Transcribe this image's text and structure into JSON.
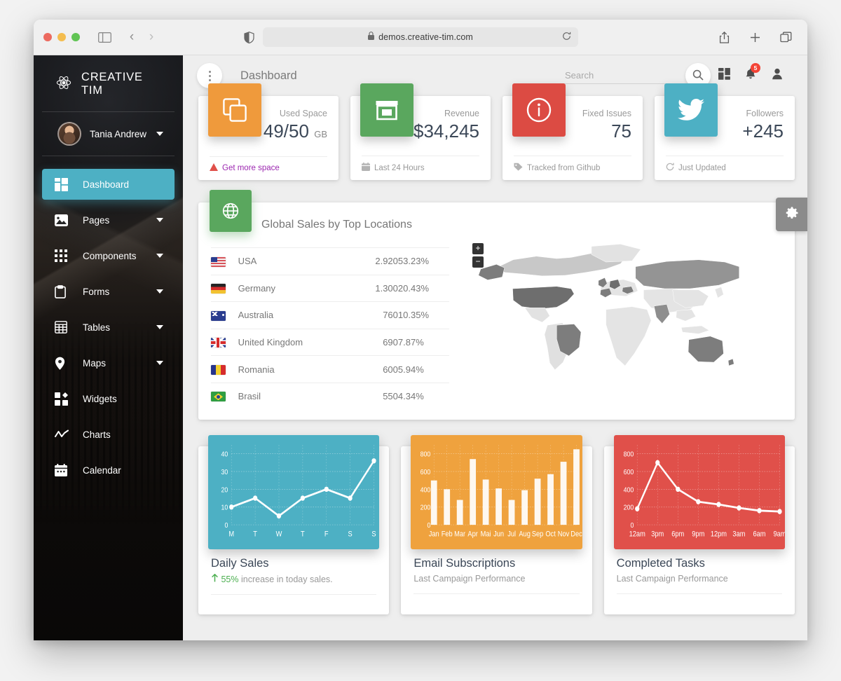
{
  "browser": {
    "url": "demos.creative-tim.com",
    "lock_icon": "lock-icon",
    "reload_icon": "reload-icon"
  },
  "sidebar": {
    "brand": "CREATIVE TIM",
    "user": {
      "name": "Tania Andrew"
    },
    "items": [
      {
        "label": "Dashboard",
        "icon": "dashboard-icon",
        "active": true,
        "caret": false
      },
      {
        "label": "Pages",
        "icon": "image-icon",
        "active": false,
        "caret": true
      },
      {
        "label": "Components",
        "icon": "apps-grid-icon",
        "active": false,
        "caret": true
      },
      {
        "label": "Forms",
        "icon": "clipboard-icon",
        "active": false,
        "caret": true
      },
      {
        "label": "Tables",
        "icon": "table-grid-icon",
        "active": false,
        "caret": true
      },
      {
        "label": "Maps",
        "icon": "map-pin-icon",
        "active": false,
        "caret": true
      },
      {
        "label": "Widgets",
        "icon": "widgets-icon",
        "active": false,
        "caret": false
      },
      {
        "label": "Charts",
        "icon": "line-chart-icon",
        "active": false,
        "caret": false
      },
      {
        "label": "Calendar",
        "icon": "calendar-icon",
        "active": false,
        "caret": false
      }
    ]
  },
  "topbar": {
    "title": "Dashboard",
    "search_placeholder": "Search",
    "search_value": "",
    "notification_count": "5"
  },
  "stats": [
    {
      "label": "Used Space",
      "value": "49/50",
      "unit": "GB",
      "footer": "Get more space",
      "footer_icon": "warning-triangle-icon",
      "footer_style": "link",
      "color": "#ef9a3c",
      "icon": "copy-icon"
    },
    {
      "label": "Revenue",
      "value": "$34,245",
      "unit": "",
      "footer": "Last 24 Hours",
      "footer_icon": "calendar-icon",
      "footer_style": "muted",
      "color": "#5aa75e",
      "icon": "store-icon"
    },
    {
      "label": "Fixed Issues",
      "value": "75",
      "unit": "",
      "footer": "Tracked from Github",
      "footer_icon": "tag-icon",
      "footer_style": "muted",
      "color": "#dc4b43",
      "icon": "info-circle-icon"
    },
    {
      "label": "Followers",
      "value": "+245",
      "unit": "",
      "footer": "Just Updated",
      "footer_icon": "refresh-icon",
      "footer_style": "muted",
      "color": "#4db0c4",
      "icon": "twitter-icon"
    }
  ],
  "sales": {
    "title": "Global Sales by Top Locations",
    "icon": "globe-icon",
    "icon_color": "#5aa75e",
    "rows": [
      {
        "flag": "flag-usa",
        "country": "USA",
        "value": "2.920",
        "percent": "53.23%"
      },
      {
        "flag": "flag-germany",
        "country": "Germany",
        "value": "1.300",
        "percent": "20.43%"
      },
      {
        "flag": "flag-australia",
        "country": "Australia",
        "value": "760",
        "percent": "10.35%"
      },
      {
        "flag": "flag-uk",
        "country": "United Kingdom",
        "value": "690",
        "percent": "7.87%"
      },
      {
        "flag": "flag-romania",
        "country": "Romania",
        "value": "600",
        "percent": "5.94%"
      },
      {
        "flag": "flag-brasil",
        "country": "Brasil",
        "value": "550",
        "percent": "4.34%"
      }
    ],
    "map": {
      "zoom_in": "+",
      "zoom_out": "−",
      "highlighted": [
        "USA",
        "Germany",
        "Australia",
        "United Kingdom",
        "Romania",
        "Brasil",
        "Russia",
        "India",
        "France"
      ]
    }
  },
  "chart_data": [
    {
      "type": "line",
      "title": "Daily Sales",
      "subtitle_highlight": "55%",
      "subtitle": "increase in today sales.",
      "subtitle_icon": "arrow-up-icon",
      "panel_color": "#4db0c4",
      "categories": [
        "M",
        "T",
        "W",
        "T",
        "F",
        "S",
        "S"
      ],
      "values": [
        10,
        15,
        5,
        15,
        20,
        15,
        36
      ],
      "ylim": [
        0,
        45
      ],
      "yticks": [
        0,
        10,
        20,
        30,
        40
      ],
      "grid": true,
      "legend": "none"
    },
    {
      "type": "bar",
      "title": "Email Subscriptions",
      "subtitle": "Last Campaign Performance",
      "panel_color": "#efa23e",
      "categories": [
        "Jan",
        "Feb",
        "Mar",
        "Apr",
        "Mai",
        "Jun",
        "Jul",
        "Aug",
        "Sep",
        "Oct",
        "Nov",
        "Dec"
      ],
      "values": [
        500,
        400,
        280,
        740,
        510,
        410,
        280,
        390,
        520,
        570,
        710,
        850
      ],
      "ylim": [
        0,
        900
      ],
      "yticks": [
        0,
        200,
        400,
        600,
        800
      ],
      "grid": true,
      "legend": "none"
    },
    {
      "type": "line",
      "title": "Completed Tasks",
      "subtitle": "Last Campaign Performance",
      "panel_color": "#e0504a",
      "categories": [
        "12am",
        "3pm",
        "6pm",
        "9pm",
        "12pm",
        "3am",
        "6am",
        "9am"
      ],
      "values": [
        180,
        700,
        400,
        260,
        230,
        190,
        160,
        150
      ],
      "ylim": [
        0,
        900
      ],
      "yticks": [
        0,
        200,
        400,
        600,
        800
      ],
      "grid": true,
      "legend": "none"
    }
  ],
  "settings_tab": {
    "icon": "gear-icon"
  }
}
